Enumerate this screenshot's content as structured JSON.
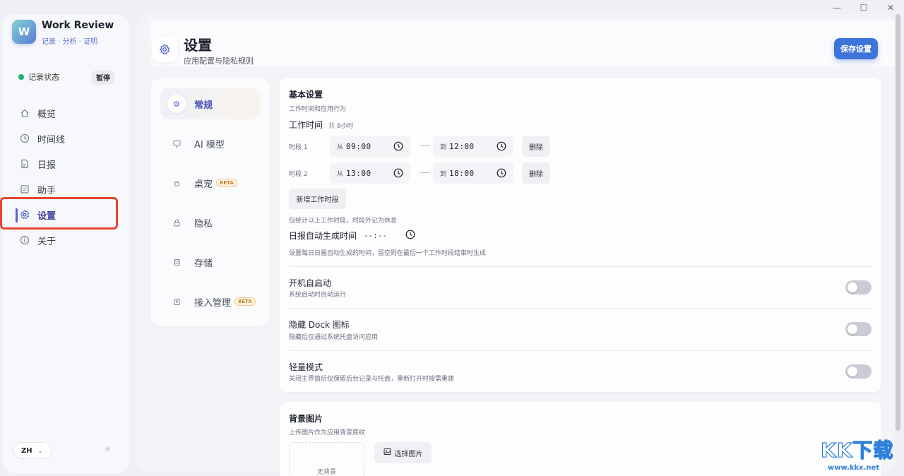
{
  "window": {
    "minimize": "—",
    "maximize": "☐",
    "close": "✕"
  },
  "sidebar": {
    "app_name": "Work Review",
    "app_tagline": "记录 · 分析 · 证明",
    "logo_letter": "W",
    "record_status_label": "记录状态",
    "pause_label": "暂停",
    "items": [
      {
        "label": "概览",
        "icon": "home-icon"
      },
      {
        "label": "时间线",
        "icon": "clock-icon"
      },
      {
        "label": "日报",
        "icon": "document-icon"
      },
      {
        "label": "助手",
        "icon": "assistant-icon"
      },
      {
        "label": "设置",
        "icon": "gear-icon",
        "active": true
      },
      {
        "label": "关于",
        "icon": "info-icon"
      }
    ],
    "language": "ZH",
    "colors": {
      "status_dot": "#21b26b",
      "active": "#5b5fd6",
      "highlight": "#e8462f"
    }
  },
  "header": {
    "title": "设置",
    "subtitle": "应用配置与隐私规则",
    "save_button": "保存设置"
  },
  "subnav": {
    "items": [
      {
        "label": "常规",
        "active": true
      },
      {
        "label": "AI 模型"
      },
      {
        "label": "桌宠",
        "badge": "BETA"
      },
      {
        "label": "隐私"
      },
      {
        "label": "存储"
      },
      {
        "label": "接入管理",
        "badge": "BETA"
      }
    ]
  },
  "basic": {
    "title": "基本设置",
    "subtitle": "工作时间和应用行为",
    "work_time_title": "工作时间",
    "work_time_total": "共 8小时",
    "slots": [
      {
        "label": "时段 1",
        "from_prefix": "从",
        "from": "09:00",
        "to_prefix": "到",
        "to": "12:00",
        "delete": "删除"
      },
      {
        "label": "时段 2",
        "from_prefix": "从",
        "from": "13:00",
        "to_prefix": "到",
        "to": "18:00",
        "delete": "删除"
      }
    ],
    "add_slot": "新增工作时段",
    "slot_hint": "仅统计以上工作时段，时段外记为休息",
    "report_time_title": "日报自动生成时间",
    "report_time_value": "--:--",
    "report_time_hint": "设置每日日报自动生成的时间，留空则在最后一个工作时段结束时生成"
  },
  "options": [
    {
      "title": "开机自启动",
      "subtitle": "系统启动时自动运行",
      "enabled": false
    },
    {
      "title": "隐藏 Dock 图标",
      "subtitle": "隐藏后仅通过系统托盘访问应用",
      "enabled": false
    },
    {
      "title": "轻量模式",
      "subtitle": "关闭主界面后仅保留后台记录与托盘，重新打开时按需重建",
      "enabled": false
    }
  ],
  "background": {
    "title": "背景图片",
    "subtitle": "上传图片作为应用背景底纹",
    "empty_label": "无背景",
    "pick_button": "选择图片"
  },
  "watermark": {
    "big": "KK下载",
    "url": "www.kkx.net"
  }
}
